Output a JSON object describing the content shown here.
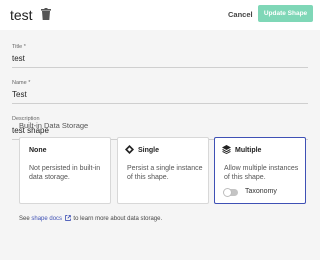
{
  "header": {
    "title": "test",
    "delete_icon": "trash-icon",
    "cancel_label": "Cancel",
    "update_label": "Update Shape",
    "update_color": "#7fd7b7"
  },
  "fields": [
    {
      "label": "Title *",
      "value": "test"
    },
    {
      "label": "Name *",
      "value": "Test"
    },
    {
      "label": "Description",
      "value": "test shape"
    }
  ],
  "storage": {
    "title": "Built-in Data Storage",
    "options": [
      {
        "title": "None",
        "description": "Not persisted in built-in data storage.",
        "icon": "",
        "selected": false
      },
      {
        "title": "Single",
        "description": "Persist a single instance of this shape.",
        "icon": "diamond-icon",
        "selected": false
      },
      {
        "title": "Multiple",
        "description": "Allow multiple instances of this shape.",
        "icon": "layers-icon",
        "selected": true
      }
    ],
    "toggle_label": "Taxonomy",
    "toggle_on": false,
    "accent_color": "#3f51b5"
  },
  "footer": {
    "prefix": "See",
    "link_text": "shape docs",
    "link_icon": "external-link-icon",
    "suffix": "to learn more about data storage."
  }
}
